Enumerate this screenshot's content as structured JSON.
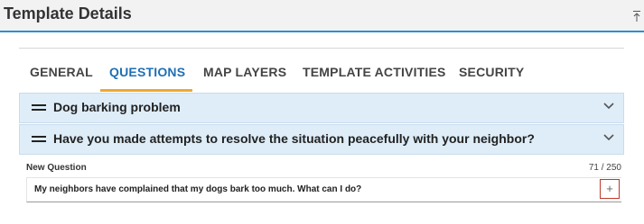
{
  "header": {
    "title": "Template Details",
    "pin_icon": "pin-to-top-icon"
  },
  "tabs": [
    {
      "label": "GENERAL",
      "active": false
    },
    {
      "label": "QUESTIONS",
      "active": true
    },
    {
      "label": "MAP LAYERS",
      "active": false
    },
    {
      "label": "TEMPLATE ACTIVITIES",
      "active": false
    },
    {
      "label": "SECURITY",
      "active": false
    }
  ],
  "questions": [
    {
      "label": "Dog barking problem",
      "expand_icon": "chevron-down-icon",
      "drag_icon": "drag-handle-icon"
    },
    {
      "label": "Have you made attempts to resolve the situation peacefully with your neighbor?",
      "expand_icon": "chevron-down-icon",
      "drag_icon": "drag-handle-icon"
    }
  ],
  "new_question": {
    "label": "New Question",
    "counter": "71 / 250",
    "value": "My neighbors have complained that my dogs bark too much. What can I do?",
    "add_icon": "plus-icon",
    "add_symbol": "+"
  },
  "colors": {
    "accent": "#2d8fd1",
    "tab_active": "#1f6fb5",
    "tab_underline": "#f0a830",
    "row_bg": "#deedf8",
    "add_border": "#c0392b"
  }
}
